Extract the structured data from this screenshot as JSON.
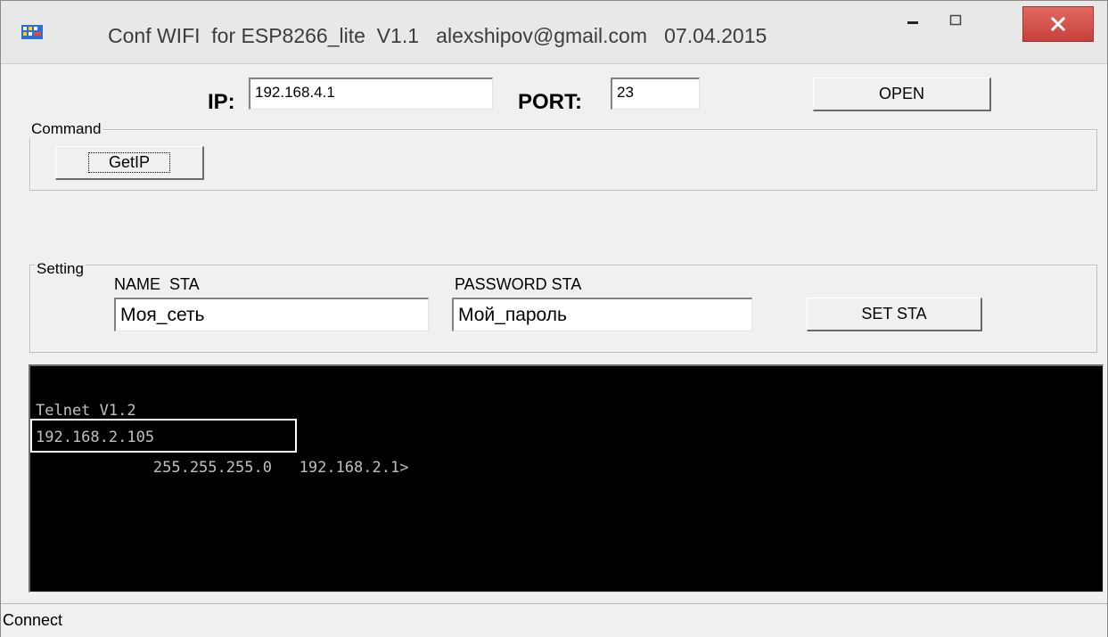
{
  "window": {
    "title": "Conf WIFI  for ESP8266_lite  V1.1   alexshipov@gmail.com   07.04.2015",
    "icon": "app-network-icon",
    "controls": {
      "minimize": "minimize-icon",
      "maximize": "maximize-icon",
      "close": "close-icon"
    }
  },
  "connection": {
    "ip_label": "IP:",
    "ip_value": "192.168.4.1",
    "port_label": "PORT:",
    "port_value": "23",
    "open_button": "OPEN"
  },
  "command_group": {
    "title": "Command",
    "getip_button": "GetIP"
  },
  "setting_group": {
    "title": "Setting",
    "name_sta_label": "NAME  STA",
    "name_sta_value": "Моя_сеть",
    "password_sta_label": "PASSWORD STA",
    "password_sta_value": "Мой_пароль",
    "set_sta_button": "SET STA"
  },
  "terminal": {
    "lines": [
      "Telnet V1.2",
      "192.168.2.105",
      "        255.255.255.0   192.168.2.1>"
    ]
  },
  "status": {
    "text": "Connect"
  },
  "colors": {
    "close_button": "#d9534f",
    "terminal_bg": "#000000",
    "terminal_text": "#c0c0c0",
    "window_bg": "#f0f0f0"
  }
}
